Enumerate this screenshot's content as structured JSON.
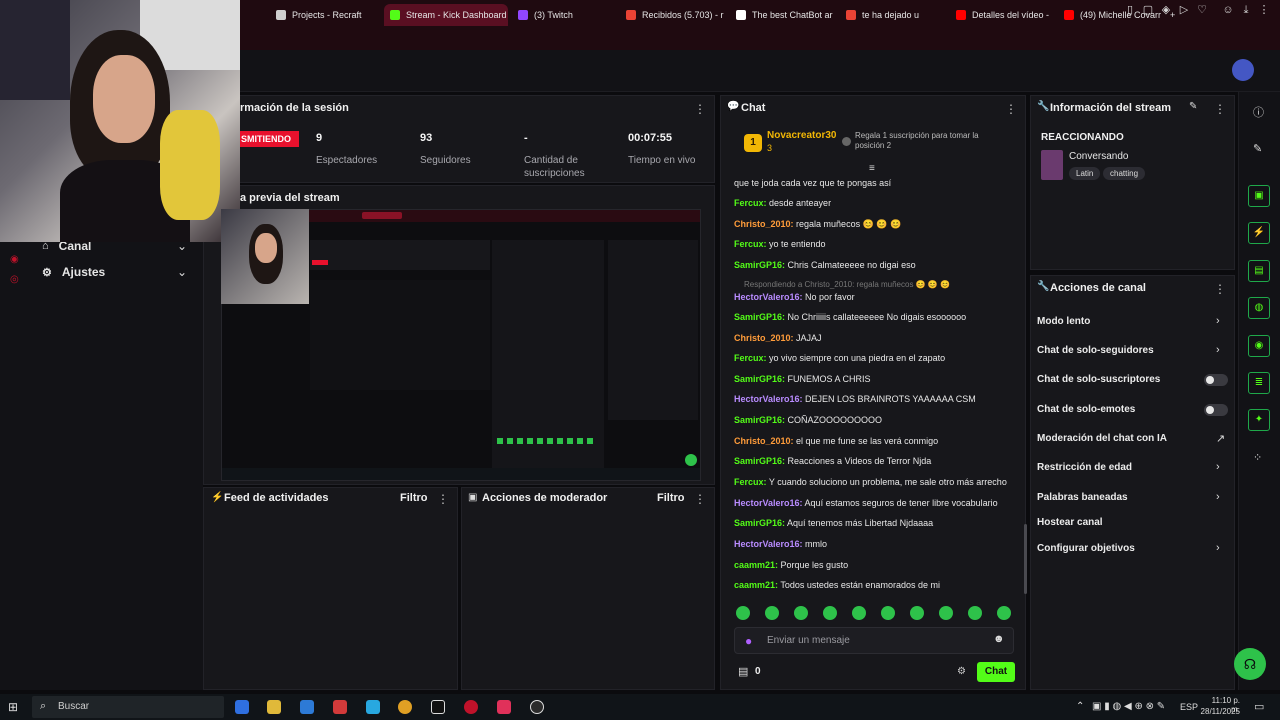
{
  "browser": {
    "tabs": [
      {
        "label": "Projects - Recraft",
        "color": "#cfcfcf"
      },
      {
        "label": "Stream - Kick Dashboard",
        "color": "#53fc18"
      },
      {
        "label": "(3) Twitch",
        "color": "#9146ff"
      },
      {
        "label": "Recibidos (5.703) - r",
        "color": "#ea4335"
      },
      {
        "label": "The best ChatBot ar",
        "color": "#ffffff"
      },
      {
        "label": "te ha dejado u",
        "color": "#ea4335"
      },
      {
        "label": "Detalles del vídeo -",
        "color": "#ff0000"
      },
      {
        "label": "(49) Michelle Covarr",
        "color": "#ff0000"
      }
    ],
    "new_tab": "+"
  },
  "sidebar": {
    "items": [
      {
        "label": "Canal",
        "icon": "channel-icon"
      },
      {
        "label": "Ajustes",
        "icon": "gear-icon"
      }
    ]
  },
  "session": {
    "title": "rmación de la sesión",
    "live_badge": "SMITIENDO",
    "stats": [
      {
        "value": "9",
        "label": "Espectadores"
      },
      {
        "value": "93",
        "label": "Seguidores"
      },
      {
        "value": "-",
        "label": "Cantidad de suscripciones"
      },
      {
        "value": "00:07:55",
        "label": "Tiempo en vivo"
      }
    ]
  },
  "preview": {
    "title": "a previa del stream"
  },
  "activity": {
    "title": "Feed de actividades",
    "filter": "Filtro"
  },
  "moderator": {
    "title": "Acciones de moderador",
    "filter": "Filtro"
  },
  "chat": {
    "title": "Chat",
    "pinned_user": "Novacreator30",
    "pinned_level": "3",
    "pinned_badge": "1",
    "gift_prompt": "Regala 1 suscripción para tomar la posición 2",
    "reply_note": "Respondiendo a Christo_2010: regala muñecos 😊 😊 😊",
    "messages": [
      {
        "user": "",
        "text": "que te joda cada vez que te pongas así",
        "color": "green"
      },
      {
        "user": "Fercux:",
        "text": " desde anteayer",
        "color": "green"
      },
      {
        "user": "Christo_2010:",
        "text": " regala muñecos 😊 😊 😊",
        "color": "orange"
      },
      {
        "user": "Fercux:",
        "text": " yo te entiendo",
        "color": "green"
      },
      {
        "user": "SamirGP16:",
        "text": " Chris Calmateeeee no digai eso",
        "color": "green"
      },
      {
        "user": "HectorValero16:",
        "text": " No por favor",
        "color": "purple"
      },
      {
        "user": "SamirGP16:",
        "text": " No Chriiiiis callateeeeee No digais esoooooo",
        "color": "green"
      },
      {
        "user": "Christo_2010:",
        "text": " JAJAJ",
        "color": "orange"
      },
      {
        "user": "Fercux:",
        "text": " yo vivo siempre con una piedra en el zapato",
        "color": "green"
      },
      {
        "user": "SamirGP16:",
        "text": " FUNEMOS A CHRIS",
        "color": "green"
      },
      {
        "user": "HectorValero16:",
        "text": " DEJEN LOS BRAINROTS YAAAAAA CSM",
        "color": "purple"
      },
      {
        "user": "SamirGP16:",
        "text": " COÑAZOOOOOOOOO",
        "color": "green"
      },
      {
        "user": "Christo_2010:",
        "text": " el que me fune se las verá conmigo",
        "color": "orange"
      },
      {
        "user": "SamirGP16:",
        "text": " Reacciones a Videos de Terror Njda",
        "color": "green"
      },
      {
        "user": "Fercux:",
        "text": " Y cuando soluciono un problema, me sale otro más arrecho",
        "color": "green"
      },
      {
        "user": "HectorValero16:",
        "text": " Aquí estamos seguros de tener libre vocabulario",
        "color": "purple"
      },
      {
        "user": "SamirGP16:",
        "text": " Aquí tenemos más Libertad Njdaaaa",
        "color": "green"
      },
      {
        "user": "HectorValero16:",
        "text": " mmlo",
        "color": "purple"
      },
      {
        "user": "caamm21:",
        "text": " Porque les gusto",
        "color": "green"
      },
      {
        "user": "caamm21:",
        "text": " Todos ustedes están enamorados de mi",
        "color": "green"
      }
    ],
    "input_placeholder": "Enviar un mensaje",
    "points": "0",
    "send_label": "Chat"
  },
  "stream_info": {
    "title": "Información del stream",
    "stream_title": "REACCIONANDO",
    "category": "Conversando",
    "tags": [
      "Latin",
      "chatting"
    ]
  },
  "channel_actions": {
    "title": "Acciones de canal",
    "items": [
      {
        "label": "Modo lento",
        "control": "chevron"
      },
      {
        "label": "Chat de solo-seguidores",
        "control": "chevron"
      },
      {
        "label": "Chat de solo-suscriptores",
        "control": "toggle"
      },
      {
        "label": "Chat de solo-emotes",
        "control": "toggle"
      },
      {
        "label": "Moderación del chat con IA",
        "control": "external"
      },
      {
        "label": "Restricción de edad",
        "control": "chevron"
      },
      {
        "label": "Palabras baneadas",
        "control": "chevron"
      },
      {
        "label": "Hostear canal",
        "control": "none"
      },
      {
        "label": "Configurar objetivos",
        "control": "chevron"
      }
    ]
  },
  "taskbar": {
    "search_placeholder": "Buscar",
    "lang": "ESP",
    "time": "11:10 p. m.",
    "date": "28/11/2025"
  },
  "colors": {
    "accent": "#53fc18",
    "live": "#e8112d",
    "tab_active": "#5a0f22"
  }
}
